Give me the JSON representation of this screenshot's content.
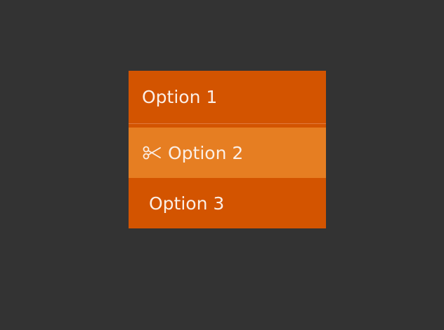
{
  "colors": {
    "background": "#333333",
    "menu": "#d35400",
    "active_item": "#e67e22",
    "text": "#fbeee5"
  },
  "menu": {
    "items": [
      {
        "label": "Option 1",
        "icon": null,
        "active": false
      },
      {
        "label": "Option 2",
        "icon": "scissors-icon",
        "active": true
      },
      {
        "label": "Option 3",
        "icon": null,
        "active": false
      }
    ]
  }
}
